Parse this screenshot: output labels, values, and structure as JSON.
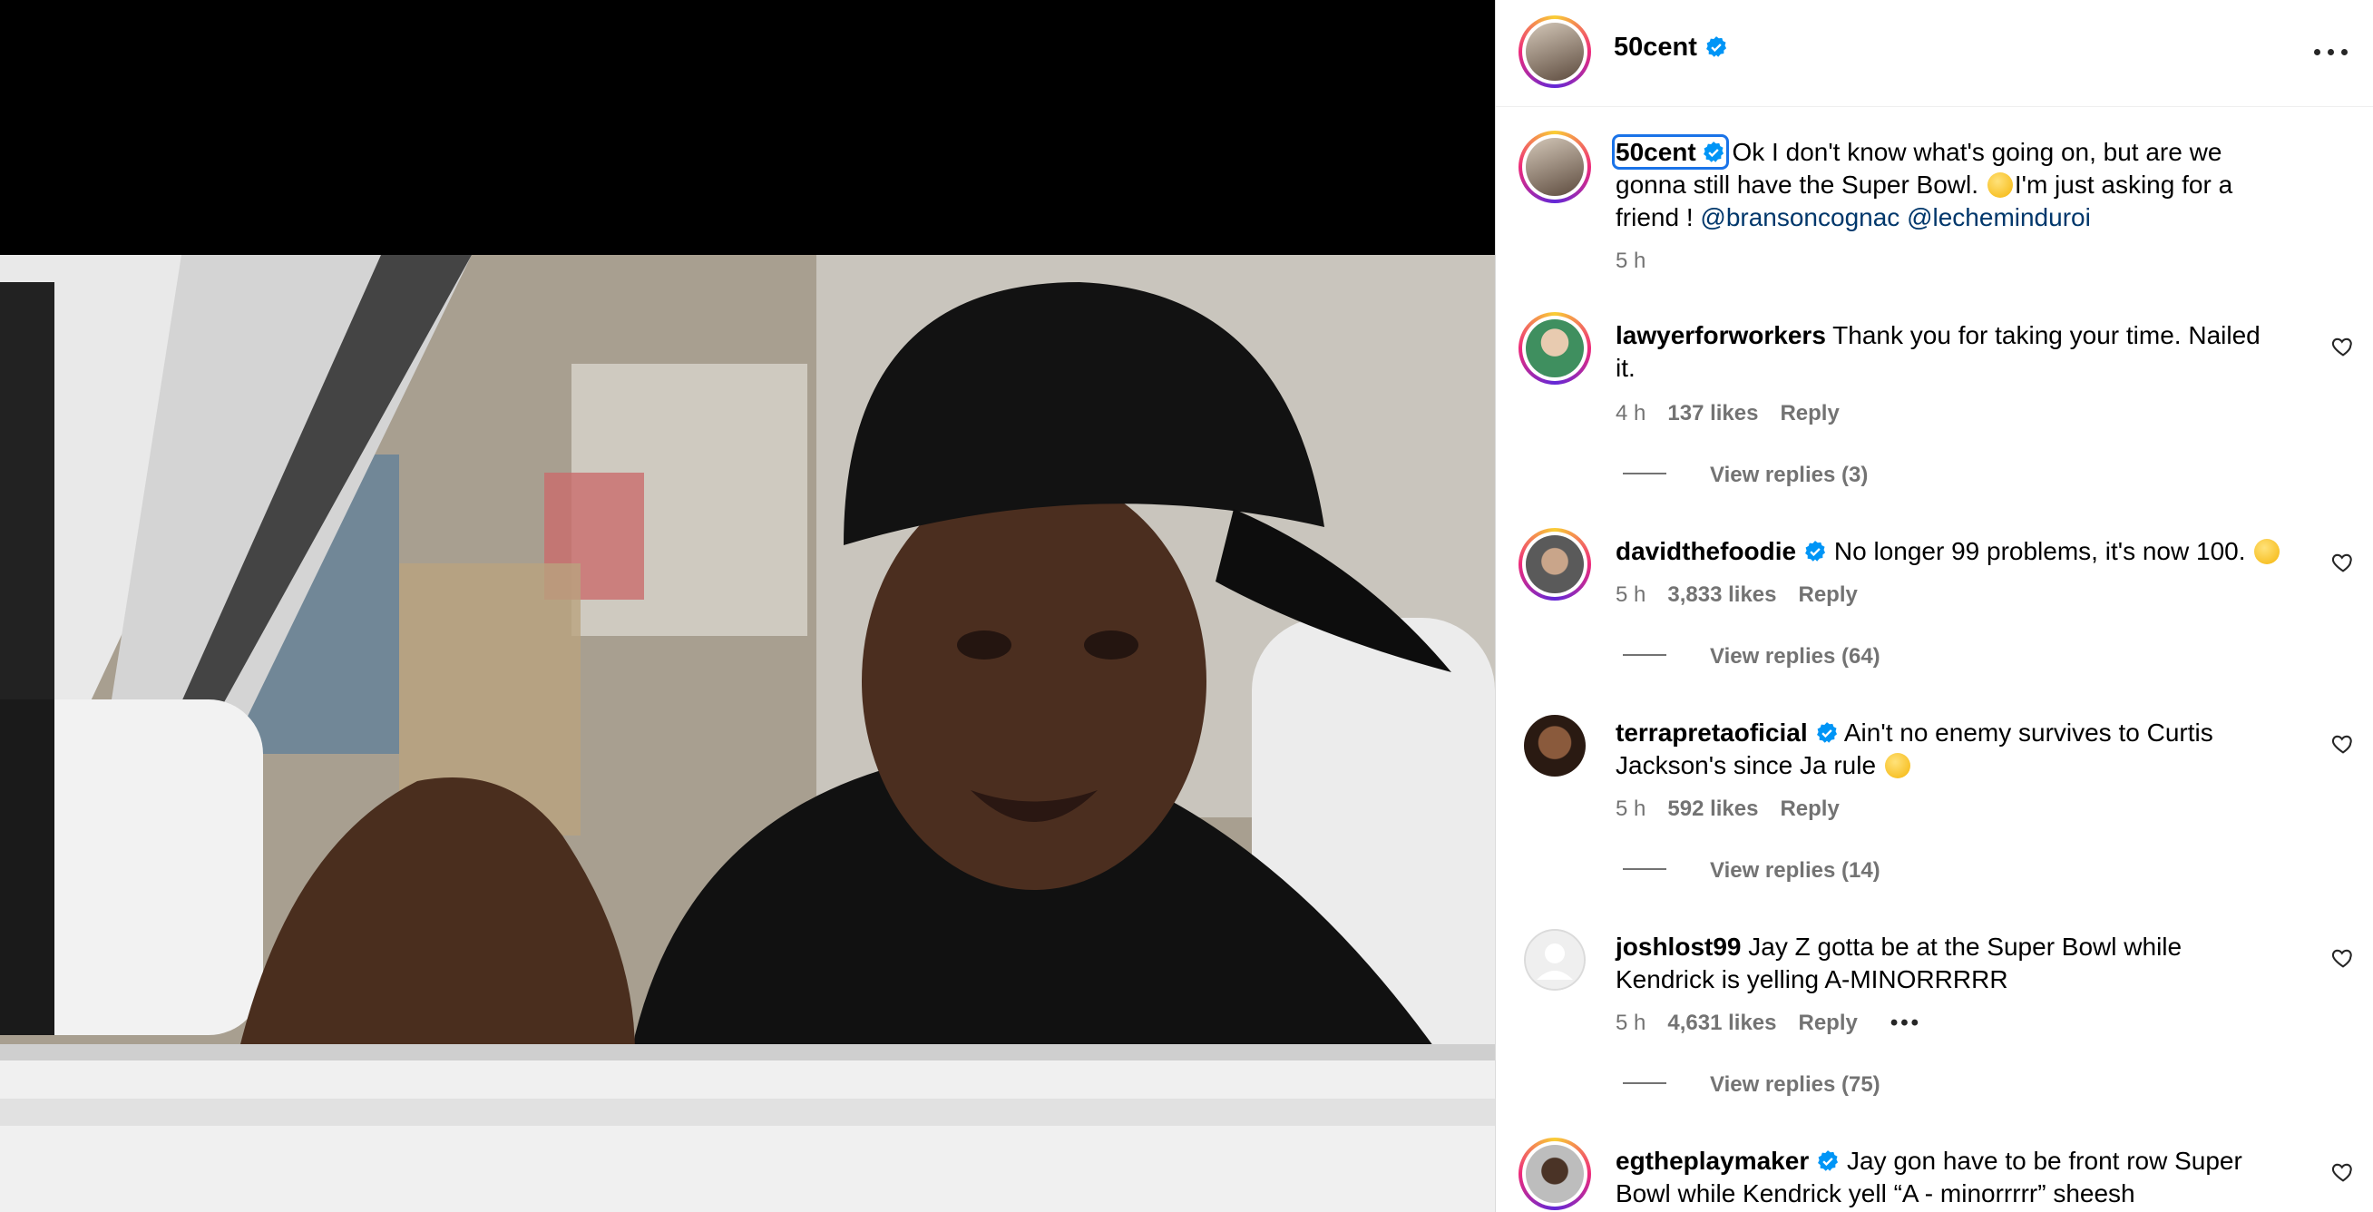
{
  "post": {
    "author": "50cent",
    "verified": true,
    "caption_text": "Ok I don't know what's going on, but are we gonna still have the Super Bowl.",
    "caption_text2": "I'm just asking for a friend !",
    "mention1": "@bransoncognac",
    "mention2": "@lecheminduroi",
    "time": "5 h"
  },
  "comments": [
    {
      "user": "lawyerforworkers",
      "verified": false,
      "text": "Thank you for taking your time. Nailed it.",
      "time": "4 h",
      "likes": "137 likes",
      "reply_label": "Reply",
      "view_replies": "View replies (3)"
    },
    {
      "user": "davidthefoodie",
      "verified": true,
      "text": "No longer 99 problems, it's now 100.",
      "time": "5 h",
      "likes": "3,833 likes",
      "reply_label": "Reply",
      "view_replies": "View replies (64)"
    },
    {
      "user": "terrapretaoficial",
      "verified": true,
      "text": "Ain't no enemy survives to Curtis Jackson's since Ja rule",
      "time": "5 h",
      "likes": "592 likes",
      "reply_label": "Reply",
      "view_replies": "View replies (14)"
    },
    {
      "user": "joshlost99",
      "verified": false,
      "text": "Jay Z gotta be at the Super Bowl while Kendrick is yelling A-MINORRRRR",
      "time": "5 h",
      "likes": "4,631 likes",
      "reply_label": "Reply",
      "more": "•••",
      "view_replies": "View replies (75)"
    },
    {
      "user": "egtheplaymaker",
      "verified": true,
      "text": "Jay gon have to be front row Super Bowl while Kendrick yell “A - minorrrrr” sheesh"
    }
  ],
  "icons": {
    "verified": "verified-badge-icon",
    "heart": "heart-outline-icon",
    "more": "more-horizontal-icon"
  },
  "colors": {
    "verified_blue": "#0095f6",
    "mention": "#00376b",
    "muted": "#737373"
  }
}
